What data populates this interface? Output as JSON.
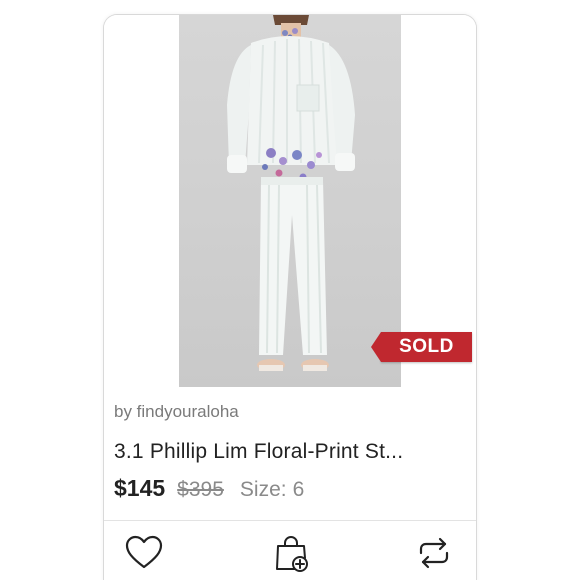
{
  "listing": {
    "seller_line": "by findyouraloha",
    "title": "3.1 Phillip Lim Floral-Print St...",
    "price": "$145",
    "original_price": "$395",
    "size_label": "Size:",
    "size_value": "6",
    "status_badge": "SOLD"
  },
  "icons": {
    "like": "heart-icon",
    "bundle": "shopping-bag-plus-icon",
    "share": "share-repost-icon"
  },
  "colors": {
    "sold_badge": "#c0282f",
    "text_primary": "#222222",
    "text_secondary": "#8a8a8a",
    "photo_background": "#d2d2d2"
  }
}
